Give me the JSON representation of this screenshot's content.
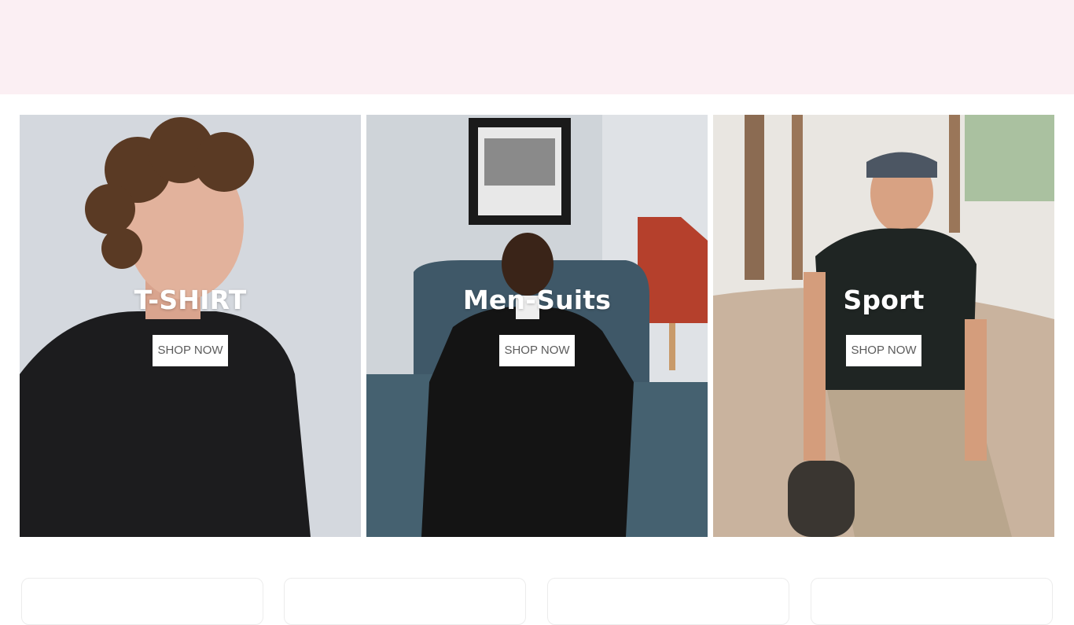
{
  "categories": [
    {
      "title": "T-SHIRT",
      "button_label": "SHOP NOW"
    },
    {
      "title": "Men-Suits",
      "button_label": "SHOP NOW"
    },
    {
      "title": "Sport",
      "button_label": "SHOP NOW"
    }
  ],
  "colors": {
    "banner_bg": "#fbeff3",
    "title_text": "#ffffff",
    "button_bg": "#ffffff",
    "button_text": "#5b5b5b"
  }
}
